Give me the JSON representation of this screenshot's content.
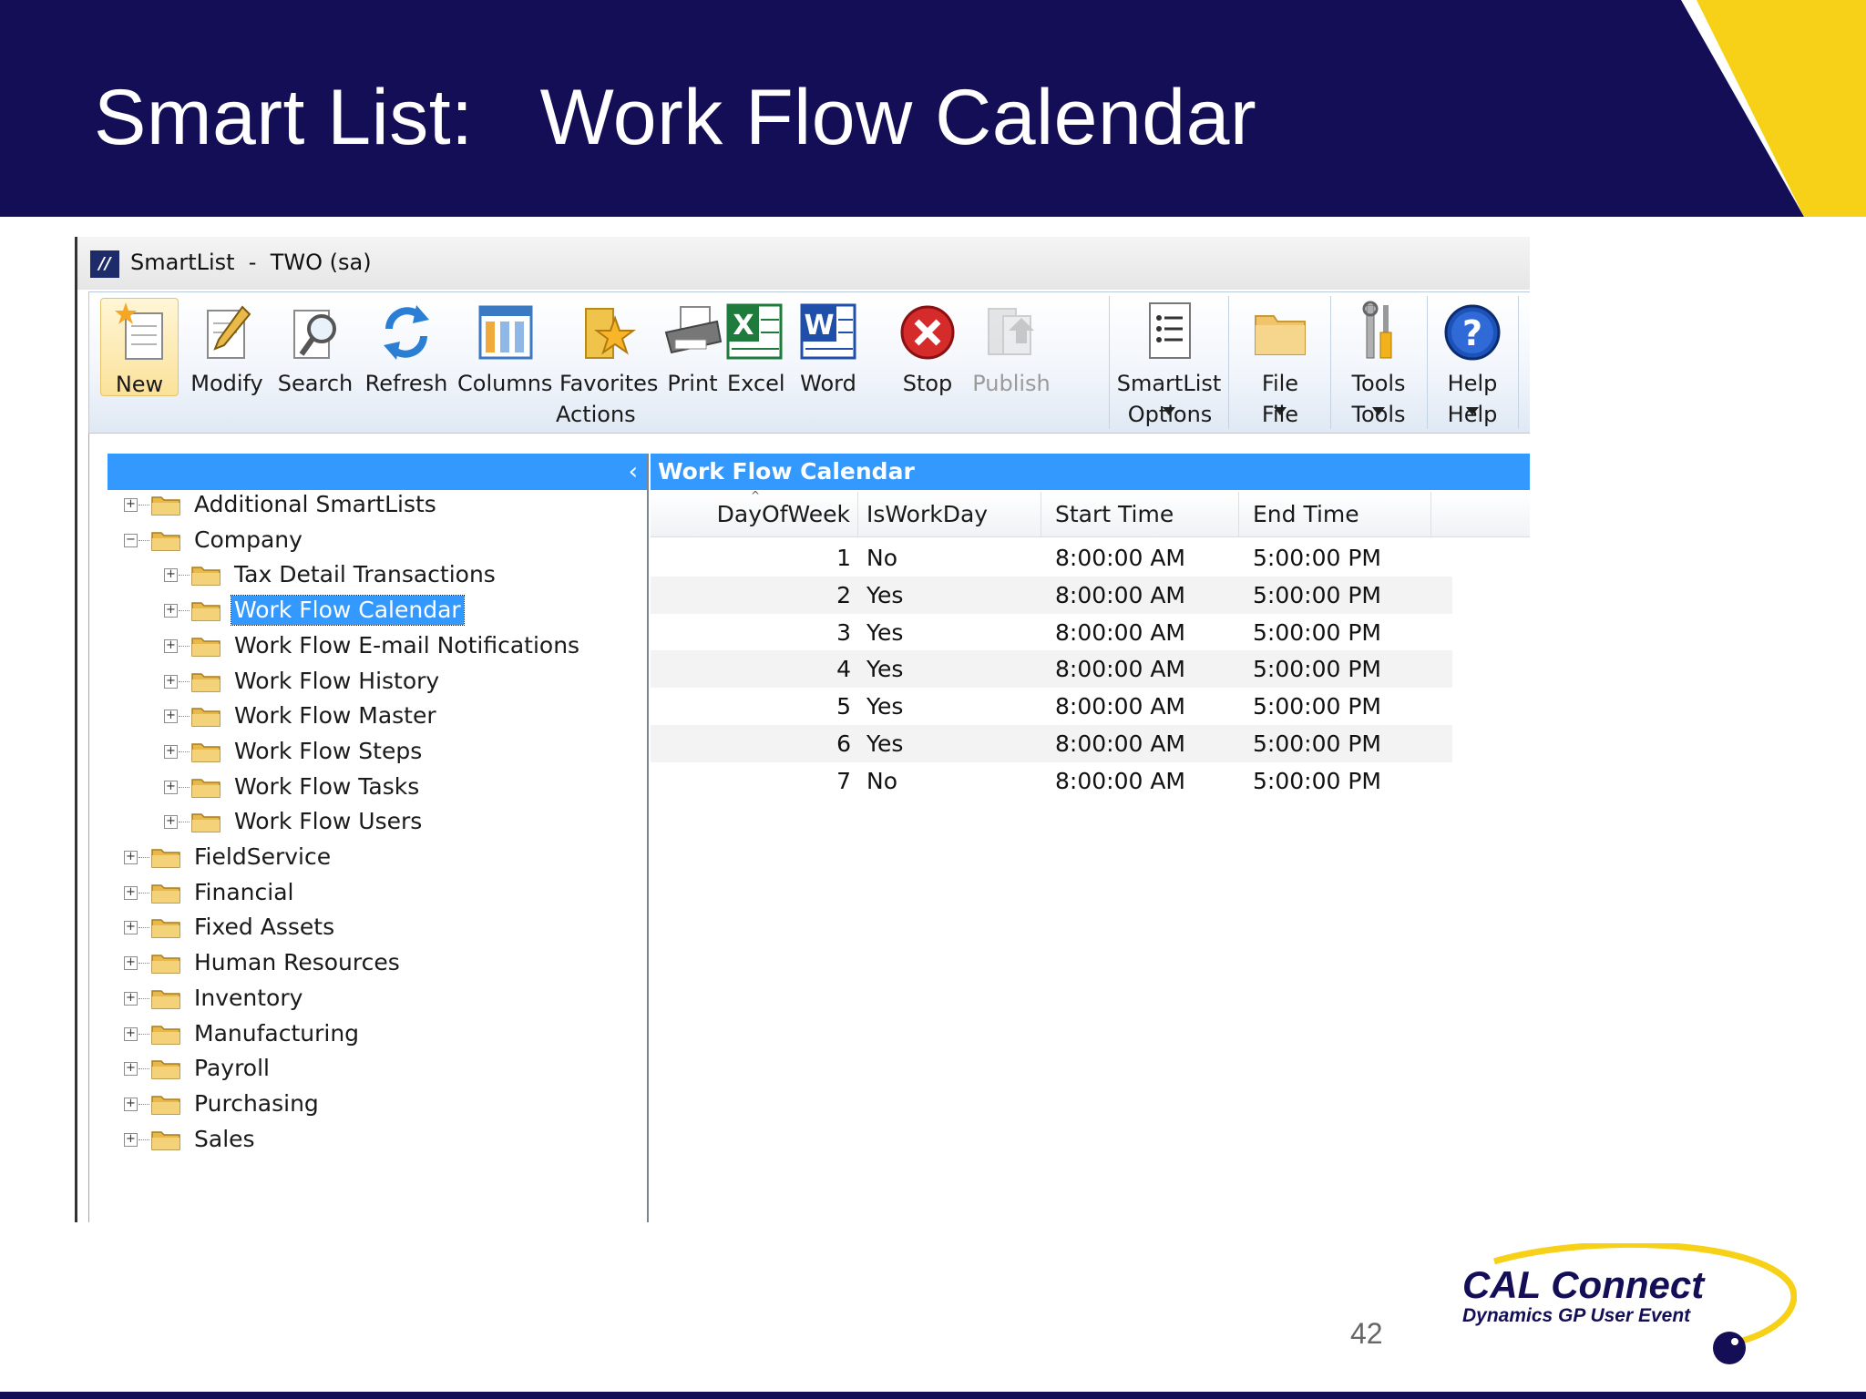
{
  "slide": {
    "title": "Smart List:   Work Flow Calendar",
    "page_number": "42",
    "logo_line1": "CAL Connect",
    "logo_line2": "Dynamics GP User Event",
    "colors": {
      "banner": "#130e55",
      "accent": "#f7d117"
    }
  },
  "window": {
    "title": "SmartList  -  TWO (sa)",
    "icon": "dynamics-gp-logo-icon"
  },
  "ribbon": {
    "buttons": [
      {
        "label": "New",
        "icon": "new-icon",
        "active": true
      },
      {
        "label": "Modify",
        "icon": "modify-icon"
      },
      {
        "label": "Search",
        "icon": "search-icon"
      },
      {
        "label": "Refresh",
        "icon": "refresh-icon"
      },
      {
        "label": "Columns",
        "icon": "columns-icon"
      },
      {
        "label": "Favorites",
        "icon": "favorites-icon"
      },
      {
        "label": "Print",
        "icon": "print-icon"
      },
      {
        "label": "Excel",
        "icon": "excel-icon"
      },
      {
        "label": "Word",
        "icon": "word-icon"
      },
      {
        "label": "Stop",
        "icon": "stop-icon"
      },
      {
        "label": "Publish",
        "icon": "publish-icon",
        "disabled": true
      },
      {
        "label": "SmartList",
        "icon": "smartlist-options-icon",
        "dropdown": true
      },
      {
        "label": "File",
        "icon": "file-folder-icon",
        "dropdown": true
      },
      {
        "label": "Tools",
        "icon": "tools-icon",
        "dropdown": true
      },
      {
        "label": "Help",
        "icon": "help-icon",
        "dropdown": true
      }
    ],
    "groups": [
      "Actions",
      "Options",
      "File",
      "Tools",
      "Help"
    ]
  },
  "tree": {
    "collapse_glyph": "‹",
    "items": [
      {
        "label": "Additional SmartLists",
        "level": 0,
        "expander": "+"
      },
      {
        "label": "Company",
        "level": 0,
        "expander": "−"
      },
      {
        "label": "Tax Detail Transactions",
        "level": 1,
        "expander": "+"
      },
      {
        "label": "Work Flow Calendar",
        "level": 1,
        "expander": "+",
        "selected": true
      },
      {
        "label": "Work Flow E-mail Notifications",
        "level": 1,
        "expander": "+"
      },
      {
        "label": "Work Flow History",
        "level": 1,
        "expander": "+"
      },
      {
        "label": "Work Flow Master",
        "level": 1,
        "expander": "+"
      },
      {
        "label": "Work Flow Steps",
        "level": 1,
        "expander": "+"
      },
      {
        "label": "Work Flow Tasks",
        "level": 1,
        "expander": "+"
      },
      {
        "label": "Work Flow Users",
        "level": 1,
        "expander": "+"
      },
      {
        "label": "FieldService",
        "level": 0,
        "expander": "+"
      },
      {
        "label": "Financial",
        "level": 0,
        "expander": "+"
      },
      {
        "label": "Fixed Assets",
        "level": 0,
        "expander": "+"
      },
      {
        "label": "Human Resources",
        "level": 0,
        "expander": "+"
      },
      {
        "label": "Inventory",
        "level": 0,
        "expander": "+"
      },
      {
        "label": "Manufacturing",
        "level": 0,
        "expander": "+"
      },
      {
        "label": "Payroll",
        "level": 0,
        "expander": "+"
      },
      {
        "label": "Purchasing",
        "level": 0,
        "expander": "+"
      },
      {
        "label": "Sales",
        "level": 0,
        "expander": "+"
      }
    ]
  },
  "grid": {
    "title": "Work Flow Calendar",
    "columns": [
      "DayOfWeek",
      "IsWorkDay",
      "Start Time",
      "End Time"
    ],
    "sort_glyph": "^",
    "rows": [
      [
        "1",
        "No",
        "8:00:00 AM",
        "5:00:00 PM"
      ],
      [
        "2",
        "Yes",
        "8:00:00 AM",
        "5:00:00 PM"
      ],
      [
        "3",
        "Yes",
        "8:00:00 AM",
        "5:00:00 PM"
      ],
      [
        "4",
        "Yes",
        "8:00:00 AM",
        "5:00:00 PM"
      ],
      [
        "5",
        "Yes",
        "8:00:00 AM",
        "5:00:00 PM"
      ],
      [
        "6",
        "Yes",
        "8:00:00 AM",
        "5:00:00 PM"
      ],
      [
        "7",
        "No",
        "8:00:00 AM",
        "5:00:00 PM"
      ]
    ]
  }
}
